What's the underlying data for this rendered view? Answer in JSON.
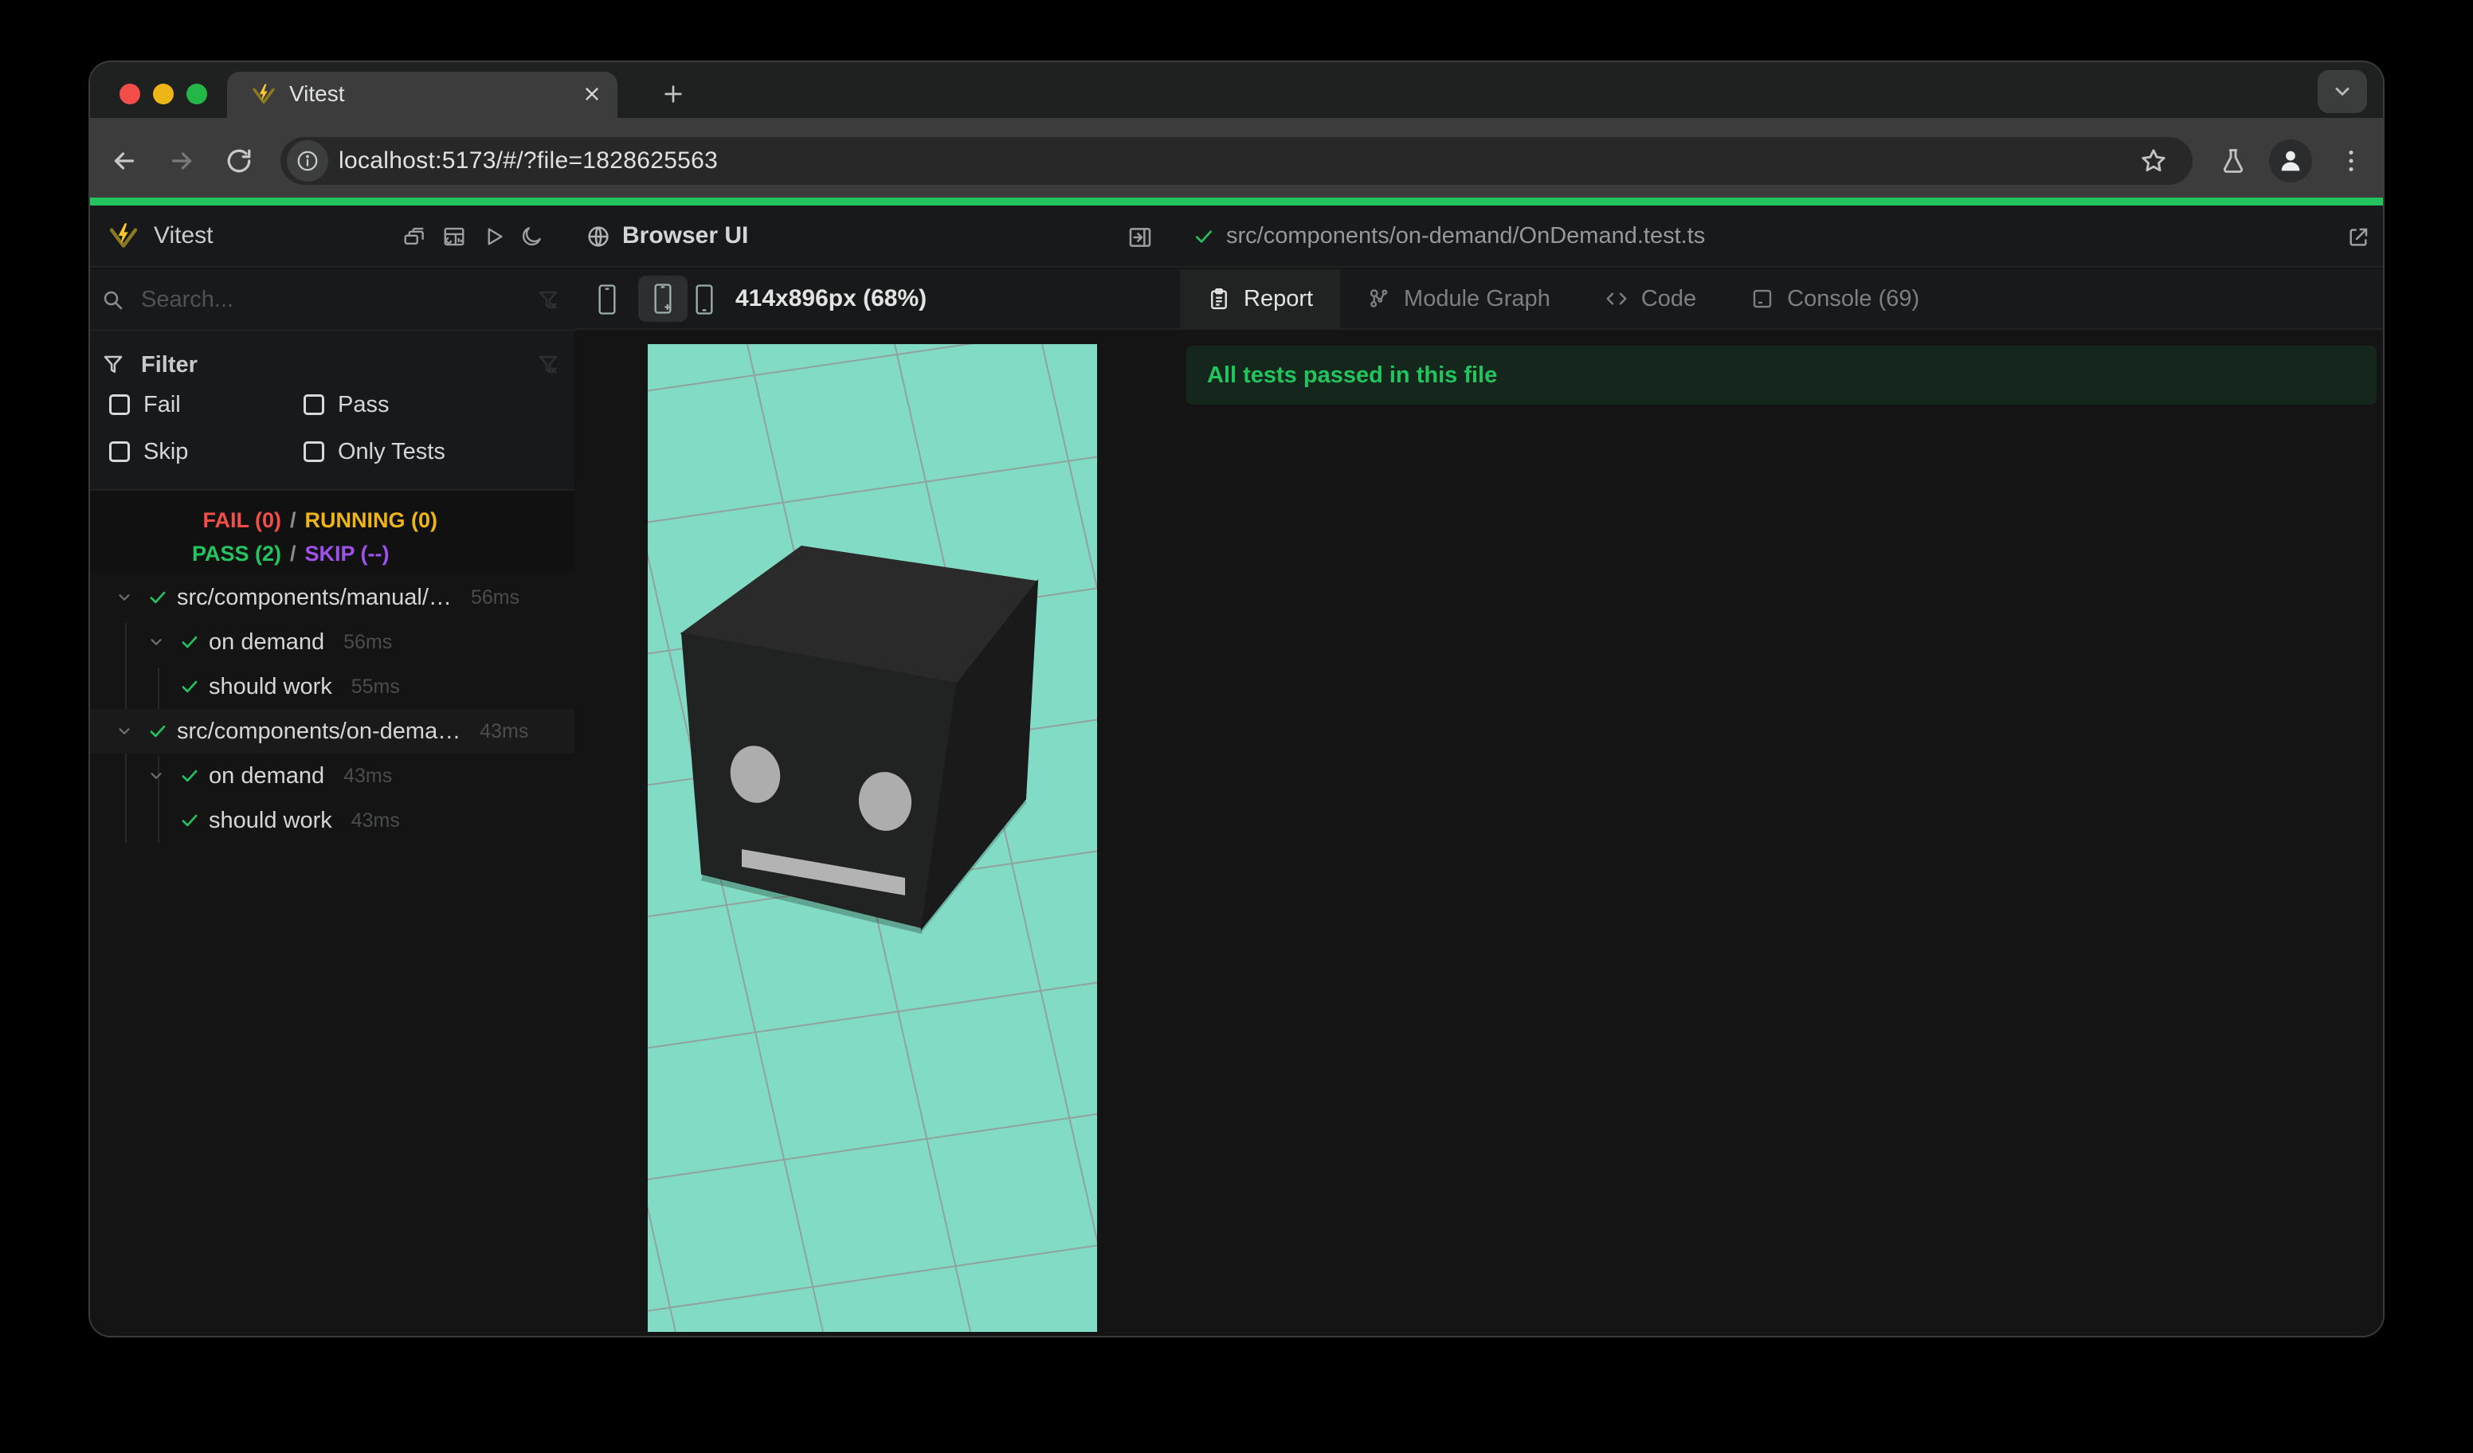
{
  "browser": {
    "tab_title": "Vitest",
    "url": "localhost:5173/#/?file=1828625563"
  },
  "sidebar": {
    "app_title": "Vitest",
    "search_placeholder": "Search...",
    "filter_title": "Filter",
    "filter_options": [
      "Fail",
      "Pass",
      "Skip",
      "Only Tests"
    ],
    "status": {
      "fail": "FAIL (0)",
      "running": "RUNNING (0)",
      "pass": "PASS (2)",
      "skip": "SKIP (--)",
      "sep": "/"
    },
    "tree": [
      {
        "label": "src/components/manual/…",
        "time": "56ms",
        "level": 0,
        "state": "pass"
      },
      {
        "label": "on demand",
        "time": "56ms",
        "level": 1,
        "state": "pass"
      },
      {
        "label": "should work",
        "time": "55ms",
        "level": 2,
        "state": "pass"
      },
      {
        "label": "src/components/on-dema…",
        "time": "43ms",
        "level": 0,
        "state": "pass",
        "selected": true
      },
      {
        "label": "on demand",
        "time": "43ms",
        "level": 1,
        "state": "pass"
      },
      {
        "label": "should work",
        "time": "43ms",
        "level": 2,
        "state": "pass"
      }
    ]
  },
  "preview": {
    "title": "Browser UI",
    "viewport_label": "414x896px (68%)"
  },
  "results": {
    "file_path": "src/components/on-demand/OnDemand.test.ts",
    "tabs": [
      "Report",
      "Module Graph",
      "Code",
      "Console (69)"
    ],
    "active_tab": "Report",
    "banner": "All tests passed in this file"
  },
  "colors": {
    "accent_green": "#22c55d",
    "viewport_teal": "#82dbc5",
    "fail_red": "#f44e4b",
    "running_yellow": "#eeb516",
    "pass_green": "#22c55e",
    "skip_purple": "#9f51eb"
  }
}
